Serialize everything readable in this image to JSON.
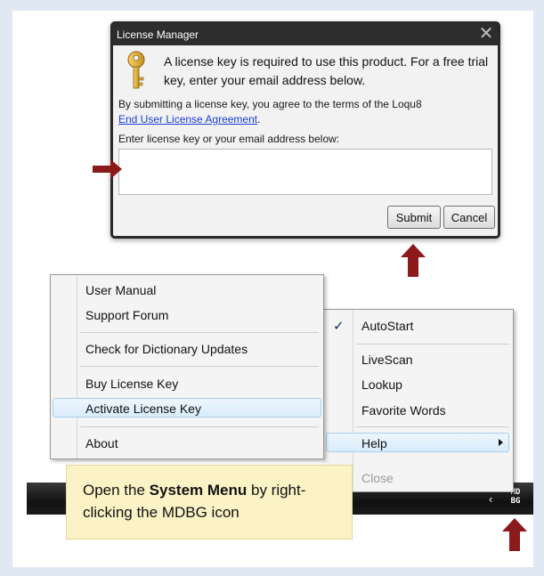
{
  "dialog": {
    "title": "License Manager",
    "close_glyph": "✕",
    "message": "A license key is required to use this product.  For a free trial key, enter your email address below.",
    "terms": "By submitting a license key, you agree to the terms of the Loqu8",
    "eula_link": "End User License Agreement",
    "eula_suffix": ".",
    "field_label": "Enter license key or your email address below:",
    "input_value": "",
    "submit_label": "Submit",
    "cancel_label": "Cancel",
    "icon": "key-icon"
  },
  "help_submenu": {
    "items": [
      {
        "label": "User Manual"
      },
      {
        "label": "Support Forum"
      },
      {
        "label": "Check for Dictionary Updates"
      },
      {
        "label": "Buy License Key"
      },
      {
        "label": "Activate License Key"
      },
      {
        "label": "About"
      }
    ],
    "highlighted": "Activate License Key"
  },
  "system_menu": {
    "items": [
      {
        "label": "AutoStart",
        "checked": true
      },
      {
        "label": "LiveScan"
      },
      {
        "label": "Lookup"
      },
      {
        "label": "Favorite Words"
      },
      {
        "label": "Help",
        "has_submenu": true
      },
      {
        "label": "Close"
      }
    ],
    "check_glyph": "✓",
    "highlighted": "Help"
  },
  "taskbar": {
    "chevron_glyph": "‹",
    "tray_icon_line1": "MD",
    "tray_icon_line2": "BG"
  },
  "tooltip": {
    "prefix": "Open the ",
    "bold": "System Menu",
    "suffix": " by right-clicking the MDBG icon"
  },
  "colors": {
    "arrow": "#8b1a1a",
    "highlight": "#d8ecfb",
    "tooltip_bg": "#fbf3c6",
    "link": "#1a3fd6"
  }
}
